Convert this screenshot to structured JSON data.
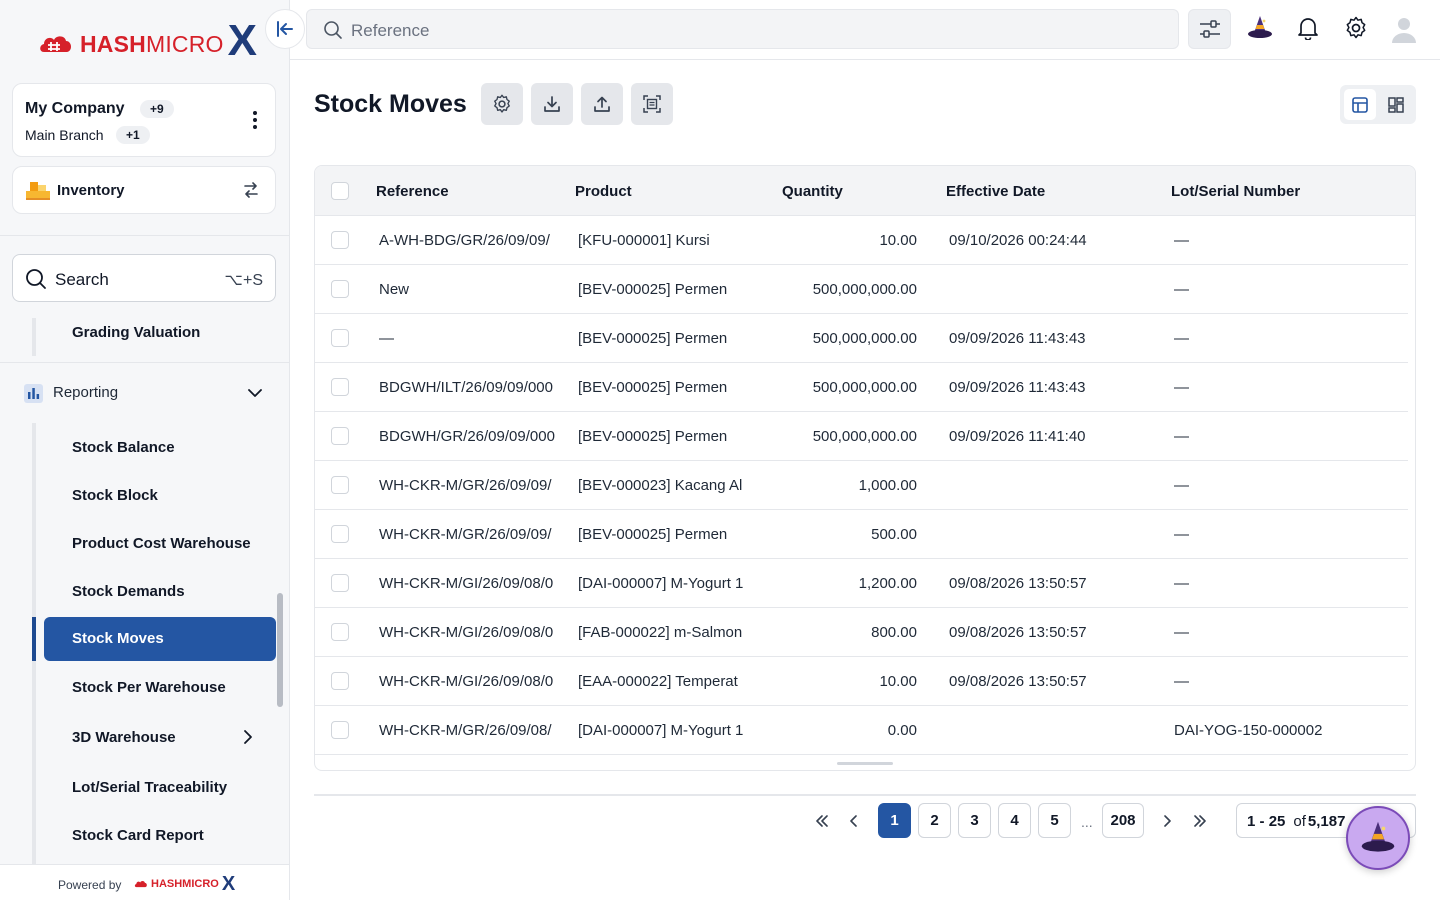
{
  "brand": {
    "logo_text_bold": "HASH",
    "logo_text_light": "MICRO",
    "logo_x": "X"
  },
  "company": {
    "name": "My Company",
    "count_badge": "+9",
    "branch": "Main Branch",
    "branch_badge": "+1"
  },
  "module": {
    "label": "Inventory"
  },
  "sidebar": {
    "search_label": "Search",
    "search_shortcut": "⌥+S",
    "top_item": "Grading Valuation",
    "section": "Reporting",
    "items": [
      {
        "label": "Stock Balance"
      },
      {
        "label": "Stock Block"
      },
      {
        "label": "Product Cost Warehouse"
      },
      {
        "label": "Stock Demands"
      },
      {
        "label": "Stock Moves",
        "active": true
      },
      {
        "label": "Stock Per Warehouse"
      },
      {
        "label": "3D Warehouse",
        "has_submenu": true
      },
      {
        "label": "Lot/Serial Traceability"
      },
      {
        "label": "Stock Card Report"
      }
    ],
    "powered_by": "Powered by",
    "powered_logo": "HASHMICRO",
    "powered_logo_x": "X"
  },
  "topbar": {
    "search_placeholder": "Reference"
  },
  "page": {
    "title": "Stock Moves"
  },
  "table": {
    "columns": [
      "Reference",
      "Product",
      "Quantity",
      "Effective Date",
      "Lot/Serial Number"
    ],
    "rows": [
      {
        "reference": "A-WH-BDG/GR/26/09/09/",
        "product": "[KFU-000001] Kursi",
        "quantity": "10.00",
        "date": "09/10/2026 00:24:44",
        "lot": "—"
      },
      {
        "reference": "New",
        "product": "[BEV-000025] Permen",
        "quantity": "500,000,000.00",
        "date": "",
        "lot": "—"
      },
      {
        "reference": "—",
        "product": "[BEV-000025] Permen",
        "quantity": "500,000,000.00",
        "date": "09/09/2026 11:43:43",
        "lot": "—"
      },
      {
        "reference": "BDGWH/ILT/26/09/09/000",
        "product": "[BEV-000025] Permen",
        "quantity": "500,000,000.00",
        "date": "09/09/2026 11:43:43",
        "lot": "—"
      },
      {
        "reference": "BDGWH/GR/26/09/09/000",
        "product": "[BEV-000025] Permen",
        "quantity": "500,000,000.00",
        "date": "09/09/2026 11:41:40",
        "lot": "—"
      },
      {
        "reference": "WH-CKR-M/GR/26/09/09/",
        "product": "[BEV-000023] Kacang Al",
        "quantity": "1,000.00",
        "date": "",
        "lot": "—"
      },
      {
        "reference": "WH-CKR-M/GR/26/09/09/",
        "product": "[BEV-000025] Permen",
        "quantity": "500.00",
        "date": "",
        "lot": "—"
      },
      {
        "reference": "WH-CKR-M/GI/26/09/08/0",
        "product": "[DAI-000007] M-Yogurt 1",
        "quantity": "1,200.00",
        "date": "09/08/2026 13:50:57",
        "lot": "—"
      },
      {
        "reference": "WH-CKR-M/GI/26/09/08/0",
        "product": "[FAB-000022] m-Salmon",
        "quantity": "800.00",
        "date": "09/08/2026 13:50:57",
        "lot": "—"
      },
      {
        "reference": "WH-CKR-M/GI/26/09/08/0",
        "product": "[EAA-000022] Temperat",
        "quantity": "10.00",
        "date": "09/08/2026 13:50:57",
        "lot": "—"
      },
      {
        "reference": "WH-CKR-M/GR/26/09/08/",
        "product": "[DAI-000007] M-Yogurt 1",
        "quantity": "0.00",
        "date": "",
        "lot": "DAI-YOG-150-000002"
      }
    ]
  },
  "pagination": {
    "pages": [
      "1",
      "2",
      "3",
      "4",
      "5"
    ],
    "ellipsis": "...",
    "last_page": "208",
    "current": "1",
    "range_from": "1",
    "range_sep": "-",
    "range_to": "25",
    "of_label": "of",
    "total": "5,187"
  },
  "colors": {
    "accent": "#2456a3",
    "brand_red": "#d6212a",
    "brand_navy": "#1f3c7a"
  }
}
